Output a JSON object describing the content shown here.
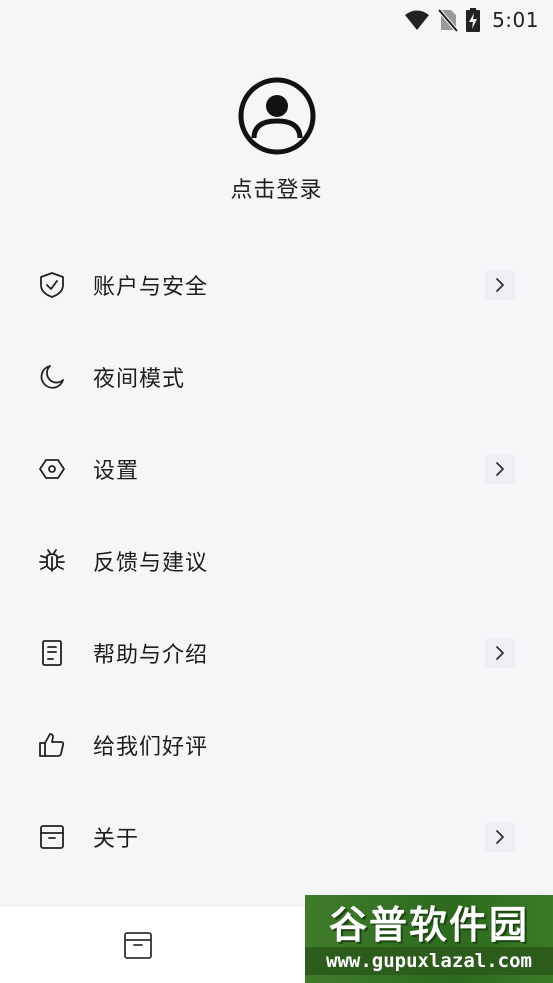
{
  "status_bar": {
    "time": "5:01"
  },
  "profile": {
    "login_label": "点击登录"
  },
  "menu": {
    "items": [
      {
        "id": "account-security",
        "label": "账户与安全",
        "icon": "shield-check-icon",
        "chevron": true
      },
      {
        "id": "night-mode",
        "label": "夜间模式",
        "icon": "moon-icon",
        "chevron": false
      },
      {
        "id": "settings",
        "label": "设置",
        "icon": "hexagon-settings-icon",
        "chevron": true
      },
      {
        "id": "feedback",
        "label": "反馈与建议",
        "icon": "bug-icon",
        "chevron": false
      },
      {
        "id": "help",
        "label": "帮助与介绍",
        "icon": "document-icon",
        "chevron": true
      },
      {
        "id": "rate-us",
        "label": "给我们好评",
        "icon": "thumbs-up-icon",
        "chevron": false
      },
      {
        "id": "about",
        "label": "关于",
        "icon": "archive-box-icon",
        "chevron": true
      }
    ]
  },
  "bottom_nav": {
    "tabs": [
      {
        "icon": "archive-box-icon"
      },
      {
        "icon": "profile-icon"
      }
    ]
  },
  "watermark": {
    "title": "谷普软件园",
    "url": "www.gupuxlazal.com"
  },
  "colors": {
    "background": "#f5f6f8",
    "text": "#1e1e1e",
    "nav_background": "#ffffff",
    "watermark_green": "#2d6a1e"
  }
}
